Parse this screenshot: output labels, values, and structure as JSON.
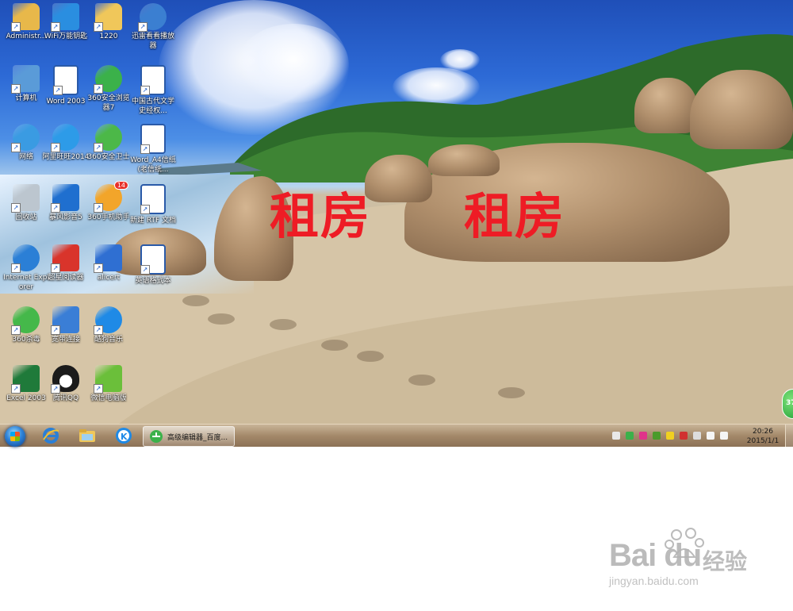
{
  "desktop": {
    "overlay_text": [
      "租房",
      "租房"
    ],
    "icons": [
      {
        "label": "Administr...",
        "icon": "user-folder-icon",
        "color": "#e8b84a"
      },
      {
        "label": "WiFi万能钥匙",
        "icon": "wifi-key-icon",
        "color": "#2a8ee0"
      },
      {
        "label": "1220",
        "icon": "folder-icon",
        "color": "#f0c75a"
      },
      {
        "label": "迅雷看看播放器",
        "icon": "xunlei-player-icon",
        "color": "#3b7fd1"
      },
      {
        "label": "计算机",
        "icon": "computer-icon",
        "color": "#5a9bd8"
      },
      {
        "label": "Word 2003",
        "icon": "word-icon",
        "color": "#2a5aa8"
      },
      {
        "label": "360安全浏览器7",
        "icon": "360-browser-icon",
        "color": "#3bb14a"
      },
      {
        "label": "中国古代文学史经权...",
        "icon": "word-doc-icon",
        "color": "#2a5aa8"
      },
      {
        "label": "网络",
        "icon": "network-icon",
        "color": "#3a9be2"
      },
      {
        "label": "阿里旺旺2014",
        "icon": "aliwangwang-icon",
        "color": "#2d9be8"
      },
      {
        "label": "360安全卫士",
        "icon": "360-safe-icon",
        "color": "#4cb848"
      },
      {
        "label": "Word_A4信纸(老信纸...",
        "icon": "word-doc-icon",
        "color": "#2a5aa8"
      },
      {
        "label": "回收站",
        "icon": "recycle-bin-icon",
        "color": "#bcc6cf"
      },
      {
        "label": "暴风影音5",
        "icon": "baofeng-icon",
        "color": "#1f6fcf"
      },
      {
        "label": "360手机助手",
        "icon": "360-phone-icon",
        "color": "#f2a52a",
        "badge": "14"
      },
      {
        "label": "新建 RTF 文档",
        "icon": "word-doc-icon",
        "color": "#2a5aa8"
      },
      {
        "label": "Internet Explorer",
        "icon": "ie-icon",
        "color": "#2b7fd6"
      },
      {
        "label": "超星阅读器",
        "icon": "chaoxing-reader-icon",
        "color": "#d9342b"
      },
      {
        "label": "alicert",
        "icon": "shield-icon",
        "color": "#2f6fd2"
      },
      {
        "label": "英语格式本",
        "icon": "word-doc-icon",
        "color": "#2a5aa8"
      },
      {
        "label": "360杀毒",
        "icon": "360-antivirus-icon",
        "color": "#45b84a"
      },
      {
        "label": "宽带连接",
        "icon": "broadband-icon",
        "color": "#3a7ed6"
      },
      {
        "label": "酷狗音乐",
        "icon": "kugou-icon",
        "color": "#1f8ae6"
      },
      {
        "label": "Excel 2003",
        "icon": "excel-icon",
        "color": "#1f7a3a"
      },
      {
        "label": "腾讯QQ",
        "icon": "qq-icon",
        "color": "#1b1b1b"
      },
      {
        "label": "微信电脑版",
        "icon": "wechat-icon",
        "color": "#6bbf3a"
      }
    ]
  },
  "taskbar": {
    "start": "start-button",
    "pinned": [
      "ie-icon",
      "explorer-icon",
      "kugou-icon"
    ],
    "active_task": {
      "label": "高级编辑器_百度...",
      "icon": "360-browser-icon"
    },
    "tray_icons": [
      "keyboard-icon",
      "360-shield-icon",
      "security-icon",
      "nvidia-icon",
      "360-safe-icon",
      "flag-icon",
      "battery-icon",
      "signal-icon",
      "volume-icon"
    ],
    "clock": {
      "time": "20:26",
      "date": "2015/1/1"
    }
  },
  "floating_bubble": {
    "value": "37"
  },
  "watermark": {
    "logo": "Bai du",
    "cn": "经验",
    "url": "jingyan.baidu.com"
  }
}
